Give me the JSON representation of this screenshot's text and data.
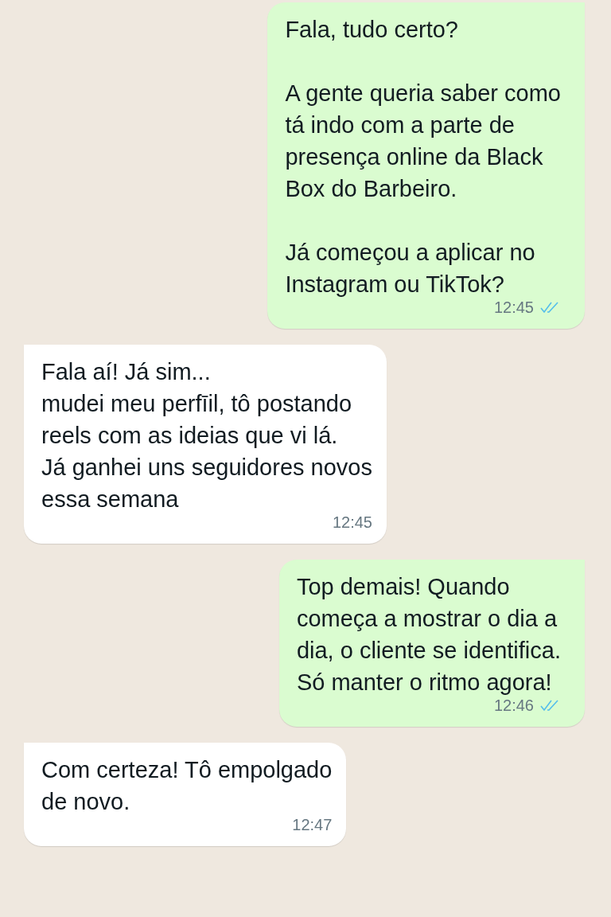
{
  "messages": [
    {
      "kind": "outgoing",
      "text": "Fala, tudo certo?\n\nA gente queria saber como\ntá indo com a parte de\npresença online da Black\nBox do Barbeiro.\n\nJá começou a aplicar no\nInstagram ou TikTok?",
      "time": "12:45",
      "read": true
    },
    {
      "kind": "incoming",
      "text": "Fala aí! Já sim...\nmudei meu perfīil, tô postando\nreels com as ideias que vi lá.\nJá ganhei uns seguidores novos\nessa semana",
      "time": "12:45"
    },
    {
      "kind": "outgoing",
      "text": "Top demais! Quando\ncomeça a mostrar o dia a\ndia, o cliente se identifica.\nSó manter o ritmo agora!",
      "time": "12:46",
      "read": true
    },
    {
      "kind": "incoming",
      "text": "Com certeza! Tô empolgado\nde novo.",
      "time": "12:47"
    }
  ]
}
